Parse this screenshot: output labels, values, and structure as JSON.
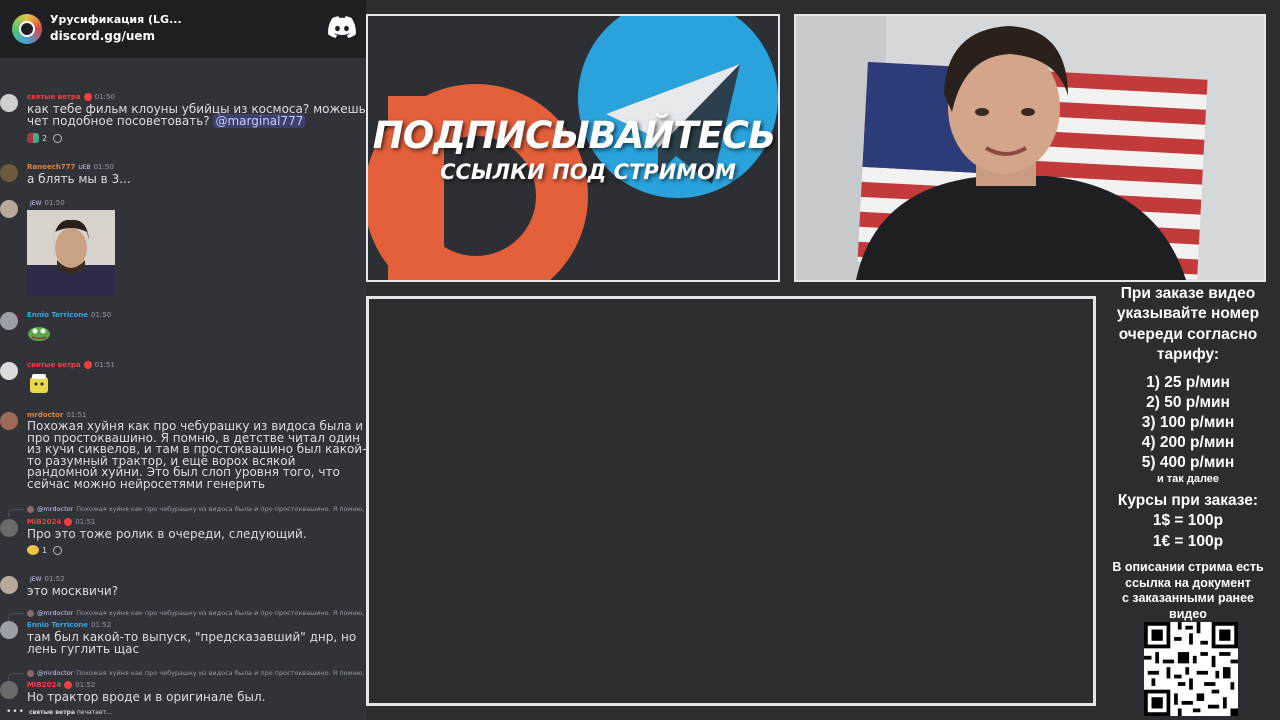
{
  "server": {
    "name": "Урусификация (LG...",
    "invite": "discord.gg/uem"
  },
  "messages": [
    {
      "author": "святые ветра",
      "author_color": "#f23f43",
      "time": "01:50",
      "text_before": "как тебе фильм клоуны убийцы из космоса? можешь чет подобное посоветовать? ",
      "mention": "@marginal777",
      "reactions": [
        {
          "count": "2"
        }
      ]
    },
    {
      "author": "Raneech777",
      "author_color": "#e2833a",
      "tag": "UEB",
      "time": "01:50",
      "text": "а блять мы в 3..."
    },
    {
      "author": "",
      "author_color": "#9b84ec",
      "tag": "JEW",
      "time": "01:50",
      "image": "webcam-snapshot"
    },
    {
      "author": "Ennio Terricone",
      "author_color": "#3ba5e0",
      "time": "01:50",
      "sticker": "pepe-sticker"
    },
    {
      "author": "святые ветра",
      "author_color": "#f23f43",
      "time": "01:51",
      "sticker": "yellow-sticker"
    },
    {
      "author": "mrdoctor",
      "author_color": "#e2833a",
      "time": "01:51",
      "text": "Похожая хуйня как про чебурашку из видоса была и про простоквашино. Я помню, в детстве читал один из кучи сиквелов, и там в простоквашино был какой-то разумный трактор, и ещё ворох всякой рандомной хуйни. Это был слоп уровня того, что сейчас можно нейросетями генерить"
    },
    {
      "reply_author": "@mrdoctor",
      "reply_text": "Похожая хуйня как про чебурашку из видоса была и про простоквашино. Я помню, в",
      "author": "MiB2024",
      "author_color": "#f23f43",
      "time": "01:51",
      "text": "Про это тоже ролик в очереди, следующий.",
      "reactions": [
        {
          "count": "1"
        }
      ]
    },
    {
      "author": "",
      "author_color": "#9b84ec",
      "tag": "JEW",
      "time": "01:52",
      "text": "это москвичи?"
    },
    {
      "reply_author": "@mrdoctor",
      "reply_text": "Похожая хуйня как про чебурашку из видоса была и про простоквашино. Я помню, в",
      "author": "Ennio Terricone",
      "author_color": "#3ba5e0",
      "time": "01:52",
      "text": "там был какой-то выпуск, \"предсказавший\" днр, но лень гуглить щас"
    },
    {
      "reply_author": "@mrdoctor",
      "reply_text": "Похожая хуйня как про чебурашку из видоса была и про простоквашино. Я помню, в",
      "author": "MiB2024",
      "author_color": "#f23f43",
      "time": "01:52",
      "text": "Но трактор вроде и в оригинале был."
    }
  ],
  "typing": {
    "user": "святые ветра",
    "suffix": "печатает..."
  },
  "promo": {
    "title": "ПОДПИСЫВАЙТЕСЬ",
    "subtitle": "ССЫЛКИ ПОД СТРИМОМ",
    "colors": {
      "patreon": "#e4603b",
      "telegram": "#2aa3dc",
      "background": "#2c2f33"
    }
  },
  "info": {
    "intro": [
      "При заказе видео",
      "указывайте номер",
      "очереди согласно",
      "тарифу:"
    ],
    "tariffs": [
      "1) 25 р/мин",
      "2) 50 р/мин",
      "3) 100 р/мин",
      "4) 200 р/мин",
      "5) 400 р/мин"
    ],
    "etc": "и так далее",
    "rates_title": "Курсы при заказе:",
    "rates": [
      "1$ = 100р",
      "1€ = 100р"
    ],
    "doc": [
      "В описании стрима есть",
      "ссылка на документ",
      "с заказанными ранее",
      "видео"
    ]
  }
}
